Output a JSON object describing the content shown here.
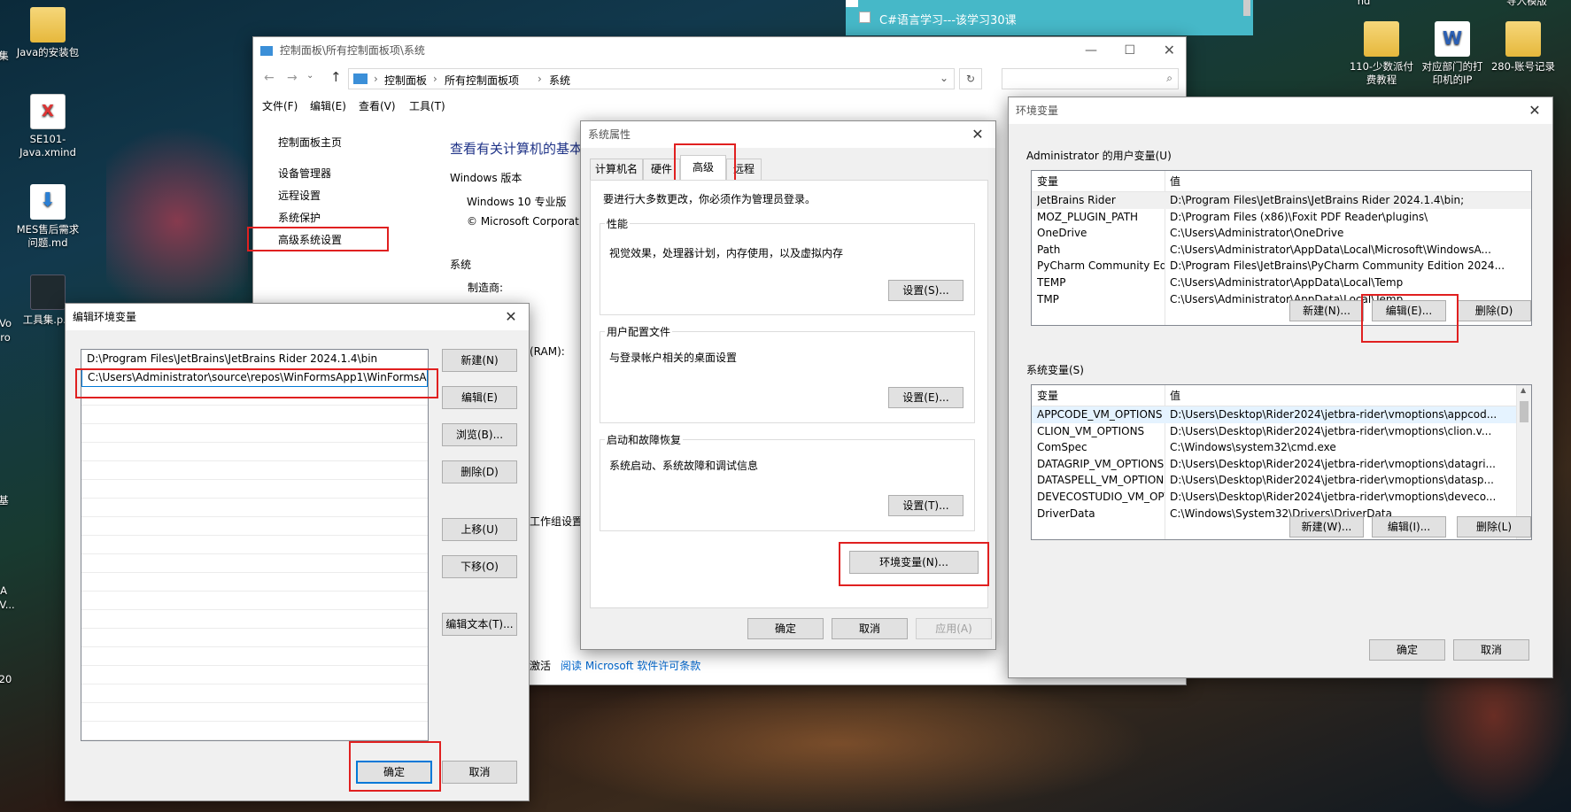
{
  "desktop": {
    "icons": [
      {
        "label": "Java的安装包",
        "glyph": "folder-shortcut-icon"
      },
      {
        "label": "SE101-Java.xmind",
        "glyph": "xmind-file-icon"
      },
      {
        "label": "MES售后需求问题.md",
        "glyph": "markdown-file-icon"
      },
      {
        "label": "工具集.p...",
        "glyph": "tools-file-icon"
      },
      {
        "label": "110-少数派付费教程",
        "glyph": "folder-icon"
      },
      {
        "label": "对应部门的打印机的IP",
        "glyph": "word-doc-icon"
      },
      {
        "label": "280-账号记录",
        "glyph": "folder-icon"
      }
    ],
    "top_right_partial": [
      "nd",
      "导入模版"
    ],
    "left_partial": [
      "集",
      "Vo",
      "ro",
      "基",
      "A",
      "V...",
      "20"
    ]
  },
  "todo": {
    "item": "C#语言学习---该学习30课"
  },
  "control_panel": {
    "title": "控制面板\\所有控制面板项\\系统",
    "breadcrumb": [
      "控制面板",
      "所有控制面板项",
      "系统"
    ],
    "menu": [
      "文件(F)",
      "编辑(E)",
      "查看(V)",
      "工具(T)"
    ],
    "sidebar": [
      "控制面板主页",
      "设备管理器",
      "远程设置",
      "系统保护",
      "高级系统设置"
    ],
    "heading": "查看有关计算机的基本",
    "windows_edition_label": "Windows 版本",
    "edition": "Windows 10 专业版",
    "copyright": "© Microsoft Corporat",
    "system_label": "系统",
    "manufacturer_label": "制造商:",
    "ram_partial": "(RAM):",
    "workgroup_partial": "工作组设置",
    "activation_partial": "激活",
    "license_link": "阅读 Microsoft 软件许可条款"
  },
  "system_properties": {
    "title": "系统属性",
    "tabs": [
      "计算机名",
      "硬件",
      "高级",
      "远程"
    ],
    "active_tab": "高级",
    "admin_note": "要进行大多数更改，你必须作为管理员登录。",
    "performance": {
      "label": "性能",
      "desc": "视觉效果，处理器计划，内存使用，以及虚拟内存",
      "button": "设置(S)..."
    },
    "user_profile": {
      "label": "用户配置文件",
      "desc": "与登录帐户相关的桌面设置",
      "button": "设置(E)..."
    },
    "startup": {
      "label": "启动和故障恢复",
      "desc": "系统启动、系统故障和调试信息",
      "button": "设置(T)..."
    },
    "env_button": "环境变量(N)...",
    "ok": "确定",
    "cancel": "取消",
    "apply": "应用(A)"
  },
  "env_vars": {
    "title": "环境变量",
    "user_section": "Administrator 的用户变量(U)",
    "col_var": "变量",
    "col_val": "值",
    "user_vars": [
      {
        "name": "JetBrains Rider",
        "value": "D:\\Program Files\\JetBrains\\JetBrains Rider 2024.1.4\\bin;"
      },
      {
        "name": "MOZ_PLUGIN_PATH",
        "value": "D:\\Program Files (x86)\\Foxit PDF Reader\\plugins\\"
      },
      {
        "name": "OneDrive",
        "value": "C:\\Users\\Administrator\\OneDrive"
      },
      {
        "name": "Path",
        "value": "C:\\Users\\Administrator\\AppData\\Local\\Microsoft\\WindowsA..."
      },
      {
        "name": "PyCharm Community Editi...",
        "value": "D:\\Program Files\\JetBrains\\PyCharm Community Edition 2024..."
      },
      {
        "name": "TEMP",
        "value": "C:\\Users\\Administrator\\AppData\\Local\\Temp"
      },
      {
        "name": "TMP",
        "value": "C:\\Users\\Administrator\\AppData\\Local\\Temp"
      }
    ],
    "user_buttons": {
      "new": "新建(N)...",
      "edit": "编辑(E)...",
      "delete": "删除(D)"
    },
    "system_section": "系统变量(S)",
    "system_vars": [
      {
        "name": "APPCODE_VM_OPTIONS",
        "value": "D:\\Users\\Desktop\\Rider2024\\jetbra-rider\\vmoptions\\appcod..."
      },
      {
        "name": "CLION_VM_OPTIONS",
        "value": "D:\\Users\\Desktop\\Rider2024\\jetbra-rider\\vmoptions\\clion.v..."
      },
      {
        "name": "ComSpec",
        "value": "C:\\Windows\\system32\\cmd.exe"
      },
      {
        "name": "DATAGRIP_VM_OPTIONS",
        "value": "D:\\Users\\Desktop\\Rider2024\\jetbra-rider\\vmoptions\\datagri..."
      },
      {
        "name": "DATASPELL_VM_OPTIONS",
        "value": "D:\\Users\\Desktop\\Rider2024\\jetbra-rider\\vmoptions\\datasp..."
      },
      {
        "name": "DEVECOSTUDIO_VM_OPT...",
        "value": "D:\\Users\\Desktop\\Rider2024\\jetbra-rider\\vmoptions\\deveco..."
      },
      {
        "name": "DriverData",
        "value": "C:\\Windows\\System32\\Drivers\\DriverData"
      }
    ],
    "system_buttons": {
      "new": "新建(W)...",
      "edit": "编辑(I)...",
      "delete": "删除(L)"
    },
    "ok": "确定",
    "cancel": "取消"
  },
  "edit_env": {
    "title": "编辑环境变量",
    "entries": [
      "D:\\Program Files\\JetBrains\\JetBrains Rider 2024.1.4\\bin",
      "C:\\Users\\Administrator\\source\\repos\\WinFormsApp1\\WinFormsA"
    ],
    "buttons": [
      "新建(N)",
      "编辑(E)",
      "浏览(B)...",
      "删除(D)",
      "上移(U)",
      "下移(O)",
      "编辑文本(T)..."
    ],
    "ok": "确定",
    "cancel": "取消"
  }
}
